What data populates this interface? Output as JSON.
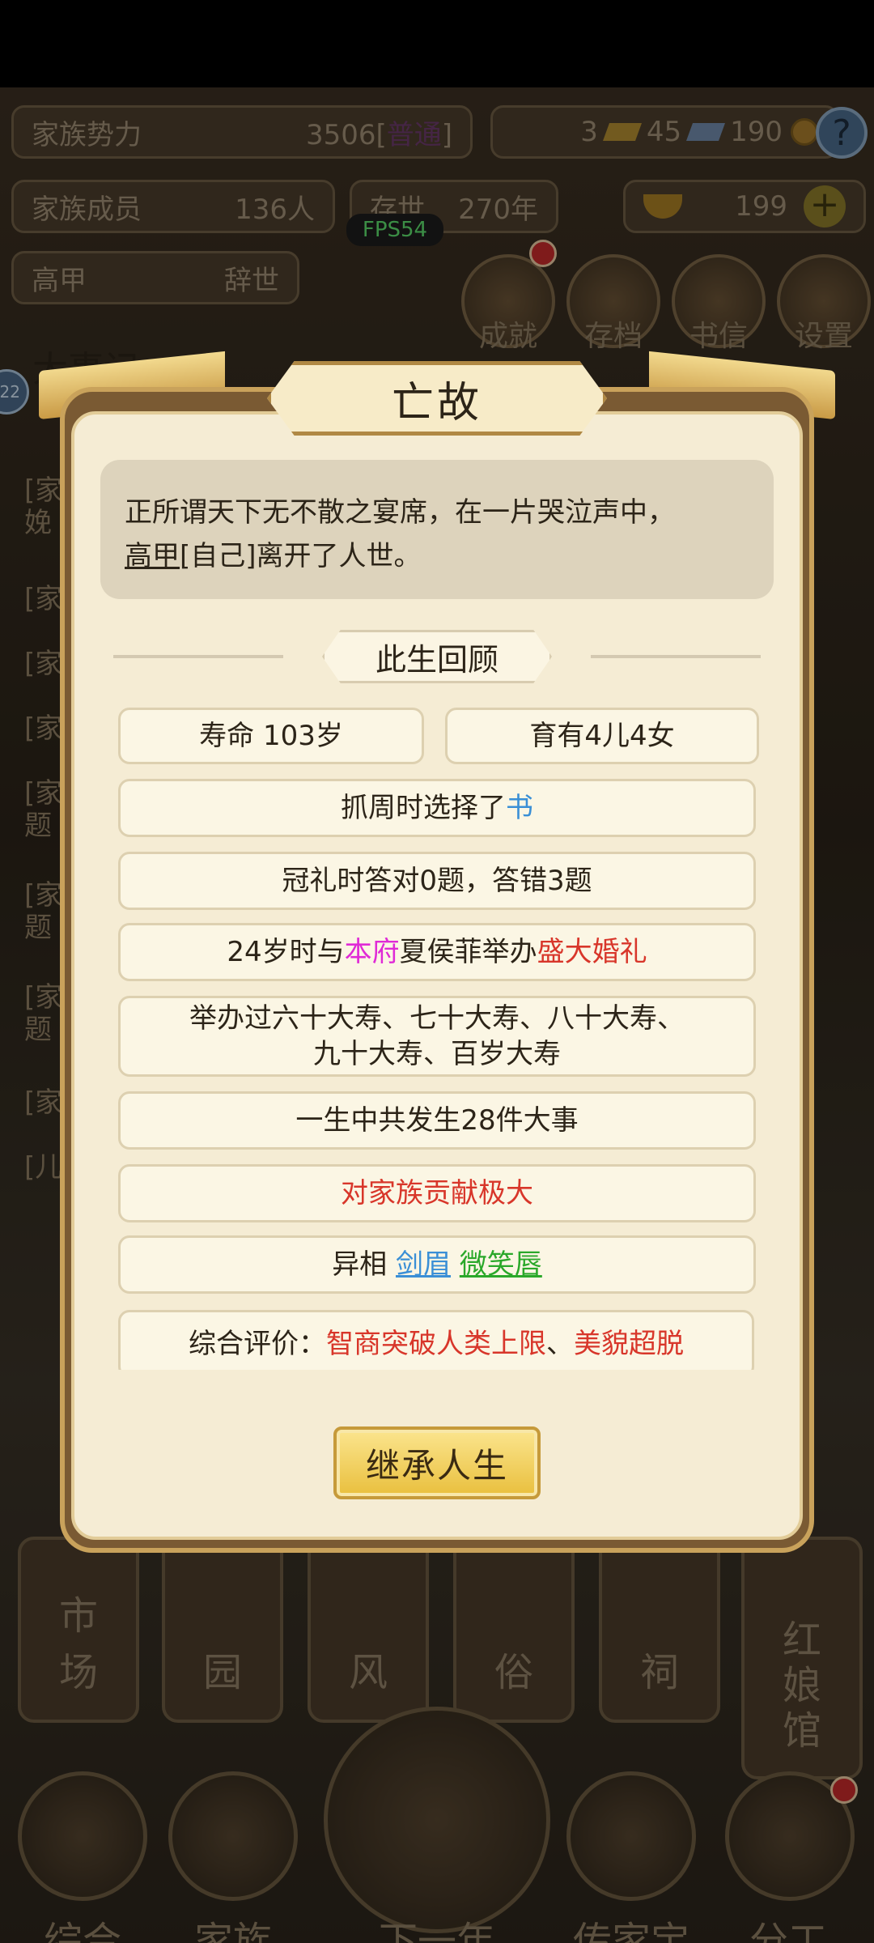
{
  "background": {
    "family_power": {
      "label": "家族势力",
      "value": "3506[",
      "rank": "普通",
      "close": "]"
    },
    "resources": {
      "gold_bars": "3",
      "silver": "45",
      "coins": "190"
    },
    "family_members": {
      "label": "家族成员",
      "value": "136人"
    },
    "exist": {
      "label": "存世",
      "value": "270年"
    },
    "ingots": {
      "value": "199"
    },
    "fps": "FPS54",
    "person": {
      "name": "高甲",
      "status": "辞世"
    },
    "round_buttons": [
      "成就",
      "存档",
      "书信",
      "设置"
    ],
    "chronicle_title": "大事记",
    "level_badge": "22",
    "log_fragments": [
      "[家",
      "娩",
      "[家",
      "[家",
      "[家",
      "[家",
      "题",
      "[家",
      "题",
      "[家",
      "题",
      "[家",
      "[儿"
    ],
    "buildings": [
      "市\n场",
      "园",
      "风",
      "俗",
      "祠",
      "红\n娘\n馆"
    ],
    "bottom_nav": [
      "综合",
      "家族",
      "下一年",
      "传家宝",
      "分工"
    ]
  },
  "modal": {
    "title": "亡故",
    "intro_line1": "正所谓天下无不散之宴席，在一片哭泣声中，",
    "intro_name": "高甲",
    "intro_line2_rest": "[自己]离开了人世。",
    "review_title": "此生回顾",
    "lifespan": "寿命 103岁",
    "children": "育有4儿4女",
    "zhuazhou_prefix": "抓周时选择了",
    "zhuazhou_item": "书",
    "guanli": "冠礼时答对0题，答错3题",
    "wedding_prefix": "24岁时与",
    "wedding_house": "本府",
    "wedding_mid": "夏侯菲举办",
    "wedding_type": "盛大婚礼",
    "birthdays_line1": "举办过六十大寿、七十大寿、八十大寿、",
    "birthdays_line2": "九十大寿、百岁大寿",
    "events": "一生中共发生28件大事",
    "contribution": "对家族贡献极大",
    "traits_prefix": "异相",
    "trait1": "剑眉",
    "trait2": "微笑唇",
    "evaluation_prefix": "综合评价：",
    "evaluation_1": "智商突破人类上限",
    "evaluation_sep": "、",
    "evaluation_2": "美貌超脱",
    "inherit_button": "继承人生"
  }
}
